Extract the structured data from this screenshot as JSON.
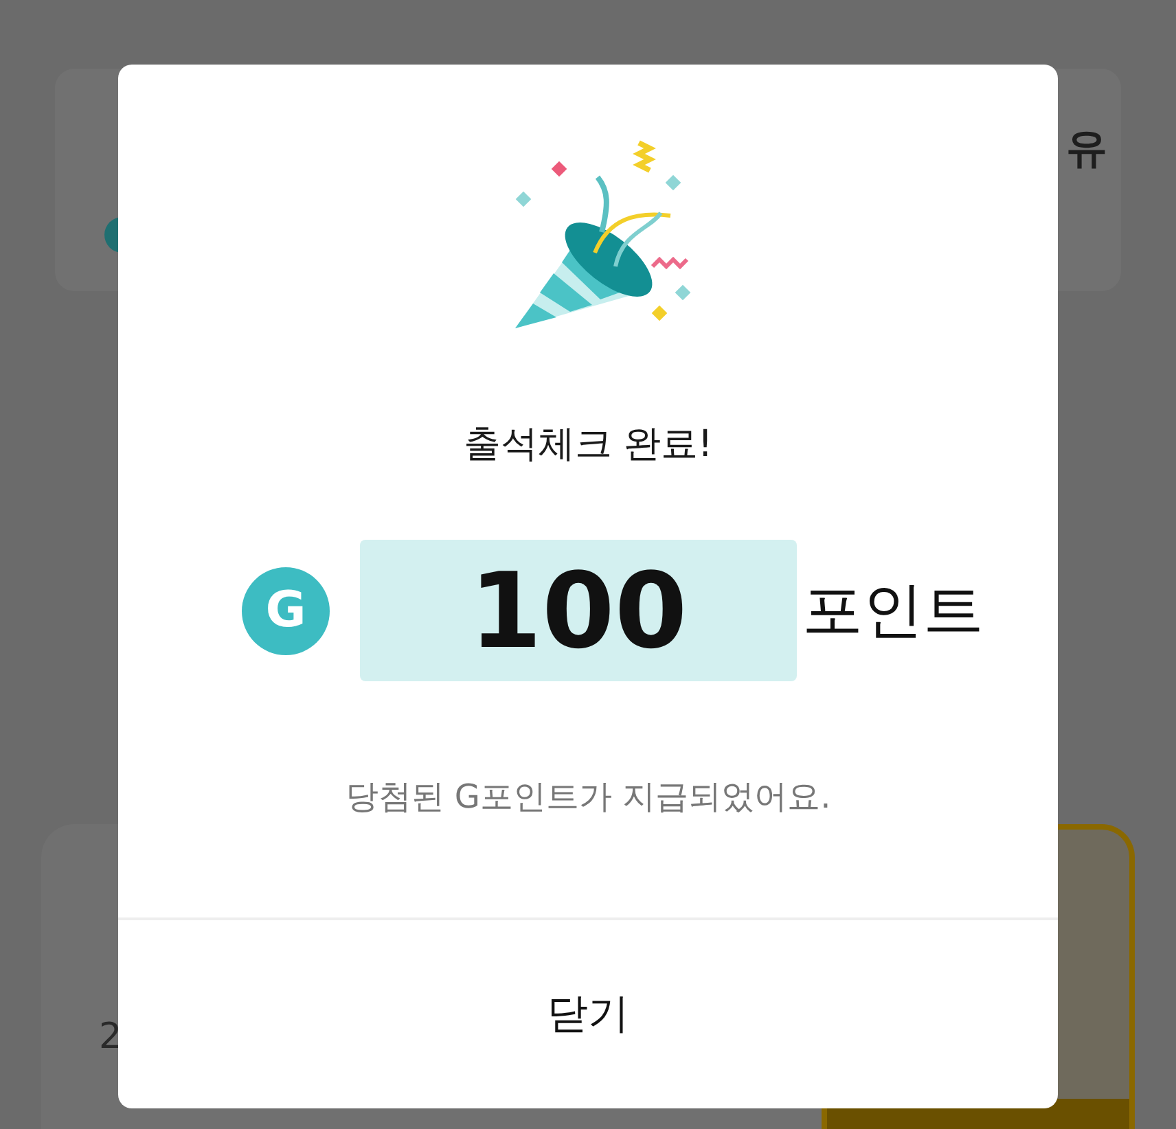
{
  "background": {
    "top_card": {
      "text": "유"
    },
    "bottom_card": {
      "text": "2"
    }
  },
  "dialog": {
    "title": "출석체크 완료!",
    "points": {
      "badge": "G",
      "amount": "100",
      "unit": "포인트"
    },
    "message": "당첨된 G포인트가 지급되었어요.",
    "close_button": "닫기"
  }
}
